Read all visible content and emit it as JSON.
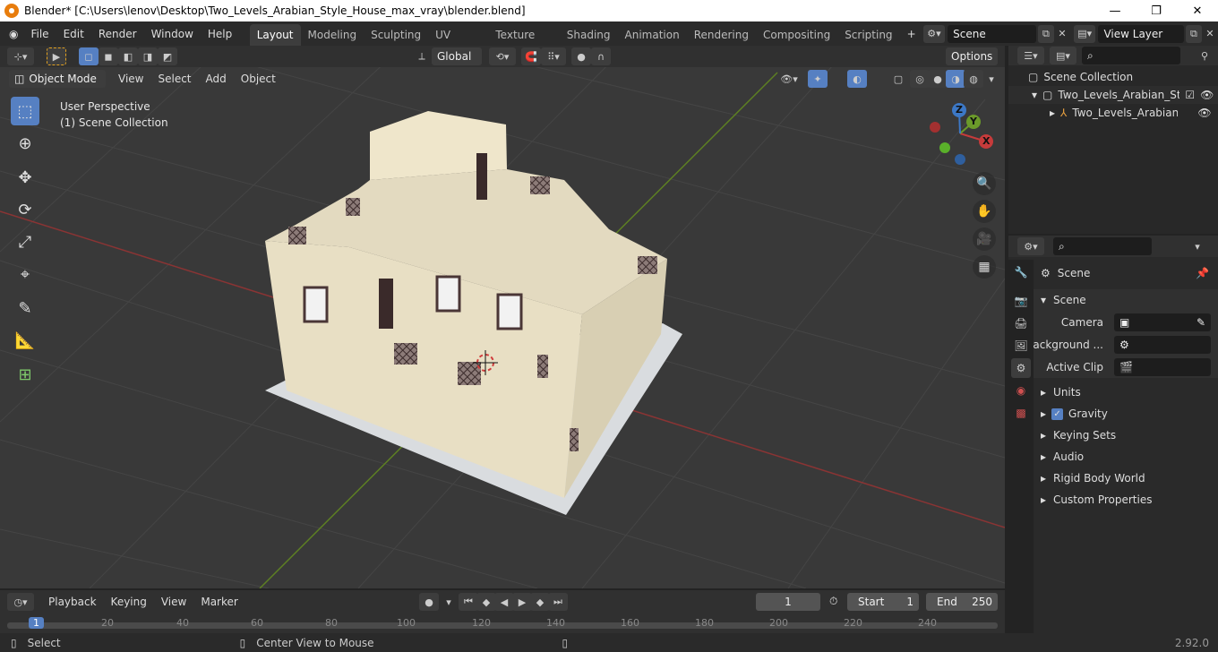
{
  "window": {
    "title": "Blender* [C:\\Users\\lenov\\Desktop\\Two_Levels_Arabian_Style_House_max_vray\\blender.blend]"
  },
  "menus": [
    "File",
    "Edit",
    "Render",
    "Window",
    "Help"
  ],
  "workspaces": [
    "Layout",
    "Modeling",
    "Sculpting",
    "UV Editing",
    "Texture Paint",
    "Shading",
    "Animation",
    "Rendering",
    "Compositing",
    "Scripting"
  ],
  "active_workspace": "Layout",
  "scene_field": "Scene",
  "view_layer_field": "View Layer",
  "viewport_header": {
    "mode": "Object Mode",
    "menus": [
      "View",
      "Select",
      "Add",
      "Object"
    ],
    "transform_orientation": "Global",
    "options": "Options"
  },
  "viewport": {
    "perspective": "User Perspective",
    "collection": "(1) Scene Collection",
    "axes": {
      "x": "X",
      "y": "Y",
      "z": "Z"
    }
  },
  "outliner": {
    "root": "Scene Collection",
    "collection": "Two_Levels_Arabian_Sty",
    "object": "Two_Levels_Arabian"
  },
  "properties": {
    "header": "Scene",
    "panel": "Scene",
    "fields": [
      {
        "label": "Camera"
      },
      {
        "label": "Background ..."
      },
      {
        "label": "Active Clip"
      }
    ],
    "sections": [
      "Units",
      "Gravity",
      "Keying Sets",
      "Audio",
      "Rigid Body World",
      "Custom Properties"
    ],
    "gravity_checked": true
  },
  "timeline": {
    "menus": [
      "Playback",
      "Keying",
      "View",
      "Marker"
    ],
    "current_frame": "1",
    "start_label": "Start",
    "start": "1",
    "end_label": "End",
    "end": "250",
    "ticks": [
      "1",
      "20",
      "40",
      "60",
      "80",
      "100",
      "120",
      "140",
      "160",
      "180",
      "200",
      "220",
      "240"
    ]
  },
  "statusbar": {
    "left": "Select",
    "middle": "Center View to Mouse",
    "version": "2.92.0"
  },
  "colors": {
    "accent": "#5680c2",
    "x_axis": "#c63b3b",
    "y_axis": "#6b9a2a",
    "wall": "#ece3c8",
    "window_dark": "#3a2a2a"
  }
}
